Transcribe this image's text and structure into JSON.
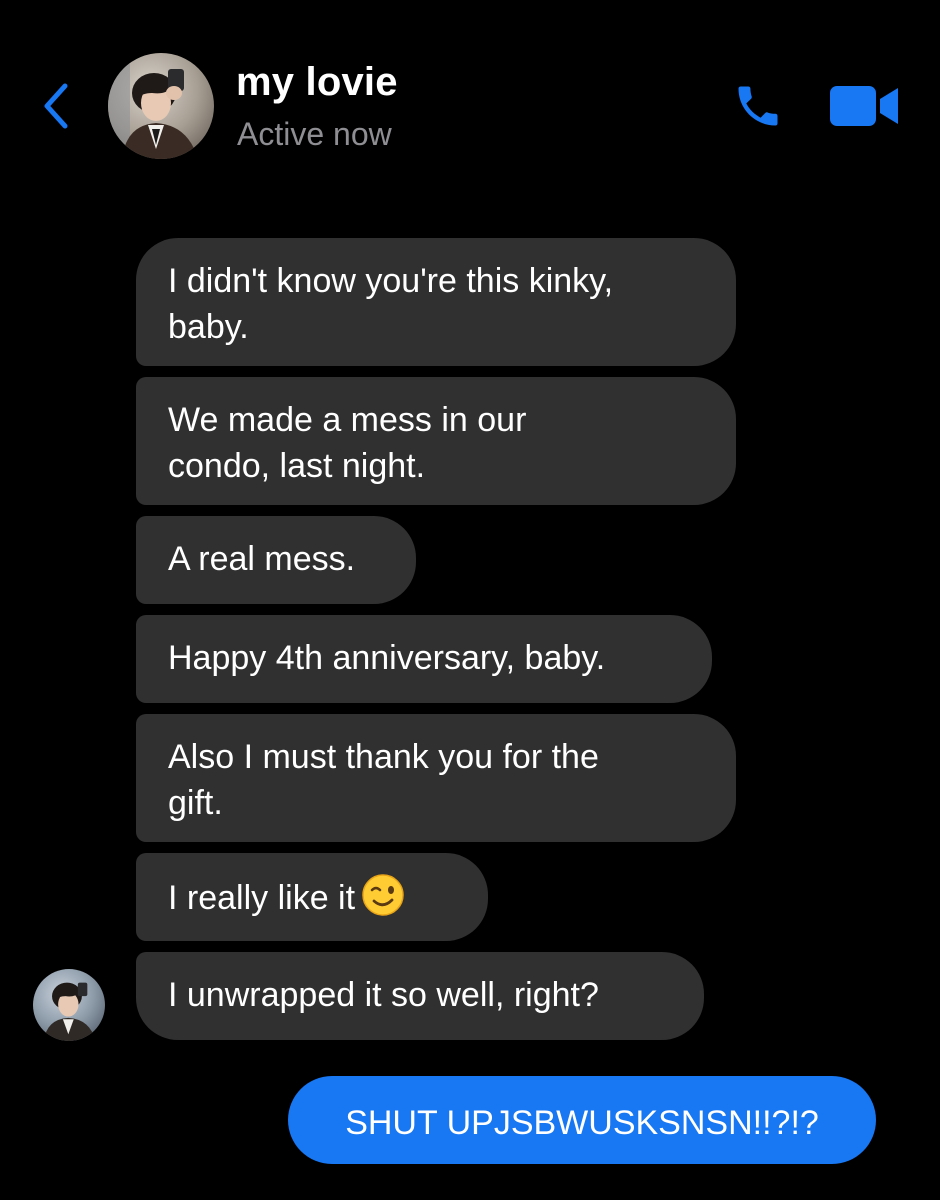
{
  "header": {
    "contact_name": "my lovie",
    "status": "Active now",
    "back_icon": "chevron-left-icon",
    "call_icon": "phone-icon",
    "video_icon": "video-camera-icon"
  },
  "colors": {
    "background": "#000000",
    "incoming_bubble": "#303030",
    "outgoing_bubble": "#1877f2",
    "accent": "#1877f2",
    "secondary_text": "#8e8e93"
  },
  "messages": [
    {
      "direction": "incoming",
      "lines": [
        "I didn't know you're this kinky,",
        "baby."
      ]
    },
    {
      "direction": "incoming",
      "lines": [
        "We made a mess in our",
        "condo, last night."
      ]
    },
    {
      "direction": "incoming",
      "lines": [
        "A real mess."
      ]
    },
    {
      "direction": "incoming",
      "lines": [
        "Happy 4th anniversary, baby."
      ]
    },
    {
      "direction": "incoming",
      "lines": [
        "Also I must thank you for the",
        "gift."
      ]
    },
    {
      "direction": "incoming",
      "lines": [
        "I really like it"
      ],
      "emoji": "winking-face"
    },
    {
      "direction": "incoming",
      "lines": [
        "I unwrapped it so well, right?"
      ],
      "shows_avatar": true
    },
    {
      "direction": "outgoing",
      "lines": [
        "SHUT UPJSBWUSKSNSN!!?!?"
      ]
    }
  ]
}
